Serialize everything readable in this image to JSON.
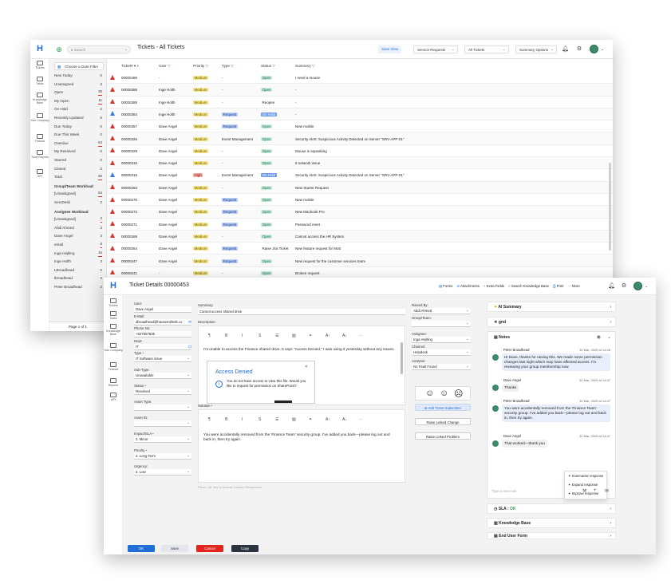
{
  "list_window": {
    "search_placeholder": "Search",
    "title": "Tickets - All Tickets",
    "save_view": "Save View",
    "dropdowns": [
      "Service Requests",
      "All Tickets",
      "Summary Options"
    ],
    "nav": [
      "Tickets",
      "Tasks",
      "Knowledge Base",
      "Your Company",
      "Finance",
      "Tools Reports",
      "API"
    ],
    "date_filter": "Choose a Date Filter",
    "filters": [
      {
        "label": "New Today",
        "count": "0"
      },
      {
        "label": "Unassigned",
        "count": "3"
      },
      {
        "label": "Open",
        "count": "35"
      },
      {
        "label": "My Open",
        "count": "11"
      },
      {
        "label": "On Hold",
        "count": "2"
      },
      {
        "label": "Recently Updated",
        "count": "6"
      },
      {
        "label": "Due Today",
        "count": "0"
      },
      {
        "label": "Due This Week",
        "count": "0"
      },
      {
        "label": "Overdue",
        "count": "54"
      },
      {
        "label": "My Resolved",
        "count": "0"
      },
      {
        "label": "Starred",
        "count": "0"
      },
      {
        "label": "Closed",
        "count": "0"
      },
      {
        "label": "Total",
        "count": "56"
      }
    ],
    "group_header": "Group/Team Workload",
    "groups": [
      {
        "label": "[Unassigned]",
        "count": "54"
      },
      {
        "label": "ServDesk",
        "count": "2"
      }
    ],
    "assignee_header": "Assignee Workload",
    "assignees": [
      {
        "label": "[Unassigned]",
        "count": "3"
      },
      {
        "label": "Abdi Ahmed",
        "count": "3"
      },
      {
        "label": "Dave Angel",
        "count": "3"
      },
      {
        "label": "email",
        "count": "8"
      },
      {
        "label": "Inga Hejlting",
        "count": "16"
      },
      {
        "label": "Inge Holth",
        "count": "3"
      },
      {
        "label": "LBroadhead",
        "count": "2"
      },
      {
        "label": "lbroadhead",
        "count": "2"
      },
      {
        "label": "Peter Broadhead",
        "count": "2"
      }
    ],
    "page_label": "Page 1 of 1",
    "columns": [
      "Ticket#",
      "User",
      "Priority",
      "Type",
      "Status",
      "Summary"
    ],
    "rows": [
      {
        "id": "00000486",
        "user": "-",
        "priority": "Medium",
        "type": "-",
        "status": "Open",
        "summary": "I need a mouse",
        "icon": "red"
      },
      {
        "id": "00000386",
        "user": "Inge Holth",
        "priority": "Medium",
        "type": "-",
        "status": "Open",
        "summary": "-",
        "icon": "red"
      },
      {
        "id": "00000385",
        "user": "Inge Holth",
        "priority": "Medium",
        "type": "-",
        "status": "Reopen",
        "summary": "-",
        "icon": "red"
      },
      {
        "id": "00000384",
        "user": "Inge Holth",
        "priority": "Medium",
        "type": "Request",
        "status": "On Hold",
        "summary": "-",
        "icon": "blue"
      },
      {
        "id": "00000357",
        "user": "Dave Angel",
        "priority": "Medium",
        "type": "Request",
        "status": "Open",
        "summary": "New mobile",
        "icon": "red"
      },
      {
        "id": "00000325",
        "user": "Dave Angel",
        "priority": "Medium",
        "type": "Event Management",
        "status": "Open",
        "summary": "Security Alert: Suspicious Activity Detected on Server \"SRV-APP-01\"",
        "icon": "red"
      },
      {
        "id": "00000329",
        "user": "Dave Angel",
        "priority": "Medium",
        "type": "-",
        "status": "Open",
        "summary": "Mouse is squeaking",
        "icon": "red"
      },
      {
        "id": "00000316",
        "user": "Dave Angel",
        "priority": "Medium",
        "type": "-",
        "status": "Open",
        "summary": "8 network issue",
        "icon": "red"
      },
      {
        "id": "00000315",
        "user": "Dave Angel",
        "priority": "High",
        "type": "Event Management",
        "status": "On Hold",
        "summary": "Security Alert: Suspicious Activity Detected on Server \"SRV-APP-01\"",
        "icon": "blue"
      },
      {
        "id": "00000283",
        "user": "Dave Angel",
        "priority": "Medium",
        "type": "-",
        "status": "Open",
        "summary": "New Starter Request",
        "icon": "red"
      },
      {
        "id": "00000276",
        "user": "Dave Angel",
        "priority": "Medium",
        "type": "Request",
        "status": "Open",
        "summary": "New mobile",
        "icon": "red"
      },
      {
        "id": "00000272",
        "user": "Dave Angel",
        "priority": "Medium",
        "type": "Request",
        "status": "Open",
        "summary": "New Macbook Pro",
        "icon": "red"
      },
      {
        "id": "00000271",
        "user": "Dave Angel",
        "priority": "Medium",
        "type": "Request",
        "status": "Open",
        "summary": "Password reset",
        "icon": "red"
      },
      {
        "id": "00000269",
        "user": "Dave Angel",
        "priority": "Medium",
        "type": "-",
        "status": "Open",
        "summary": "Cannot access the HR System",
        "icon": "red"
      },
      {
        "id": "00000264",
        "user": "Dave Angel",
        "priority": "Medium",
        "type": "Request",
        "status": "Raise Jira Ticket",
        "summary": "New feature request for Mott",
        "icon": "red"
      },
      {
        "id": "00000247",
        "user": "Dave Angel",
        "priority": "Medium",
        "type": "Request",
        "status": "Open",
        "summary": "New request for the customer services team",
        "icon": "red"
      },
      {
        "id": "00000241",
        "user": "-",
        "priority": "Medium",
        "type": "-",
        "status": "Open",
        "summary": "Broken request",
        "icon": "red"
      }
    ]
  },
  "detail_window": {
    "title": "Ticket Details 00000453",
    "toolbar": [
      "Forms",
      "Attachments",
      "Extra Fields",
      "Search Knowledge Base",
      "Print",
      "More"
    ],
    "nav": [
      "Tickets",
      "Tasks",
      "Knowledge Base",
      "Your Company",
      "Finance",
      "Reports",
      "API"
    ],
    "left_fields": [
      {
        "label": "User:",
        "value": "Dave Angel",
        "required": false,
        "dropdown": false
      },
      {
        "label": "E-Mail:",
        "value": "dbroadhead@hausemithelit.co",
        "required": false,
        "dropdown": false
      },
      {
        "label": "Phone No:",
        "value": "+527557835",
        "required": false,
        "dropdown": false
      },
      {
        "label": "Dept:",
        "value": "IT",
        "required": false,
        "dropdown": false
      },
      {
        "label": "Type",
        "value": "IT Software issue",
        "required": true,
        "dropdown": true
      },
      {
        "label": "Sub-Type:",
        "value": "Unavailable",
        "required": false,
        "dropdown": true
      },
      {
        "label": "Status",
        "value": "Resolved",
        "required": true,
        "dropdown": true
      },
      {
        "label": "Asset Type:",
        "value": "",
        "required": false,
        "dropdown": true
      },
      {
        "label": "Asset ID:",
        "value": "",
        "required": false,
        "dropdown": true
      },
      {
        "label": "Impact/SLA",
        "value": "2. Minor",
        "required": true,
        "dropdown": true
      },
      {
        "label": "Priority",
        "value": "4. Long Term",
        "required": true,
        "dropdown": true
      },
      {
        "label": "Urgency:",
        "value": "2. Low",
        "required": false,
        "dropdown": true
      }
    ],
    "summary_label": "Summary:",
    "summary_value": "Cannot access shared drive",
    "description_label": "Description:",
    "description_text": "I'm unable to access the Finance shared drive. It says \"Access Denied.\" I was using it yesterday without any issues.",
    "dialog_title": "Access Denied",
    "dialog_text": "You do not have access to view this file. Would you like to request for permission on SharePoint?",
    "solution_label": "Solution",
    "solution_text": "You were accidentally removed from the 'Finance Team' security group. I've added you back—please log out and back in, then try again.",
    "hint": "Press '/@' key to access Canned Responses",
    "mid_fields": [
      {
        "label": "Raised By:",
        "value": "Abdi Ahmed"
      },
      {
        "label": "Group/Team:",
        "value": ""
      },
      {
        "label": "Assignee:",
        "value": "Inga Hejlting"
      },
      {
        "label": "Channel:",
        "value": "Helpdesk"
      },
      {
        "label": "Analysis:",
        "value": "No Fault Found"
      }
    ],
    "add_subscriber": "Add Ticket Subscriber",
    "link_change": "Raise Linked Change",
    "link_problem": "Raise Linked Problem",
    "ai_summary": "AI Summary",
    "gnd": "gnd",
    "notes_label": "Notes",
    "notes": [
      {
        "author": "Peter Broadhead",
        "date": "31 Mar, 2025 at 14:46",
        "text": "Hi Dave, thanks for raising this. We made some permission changes last night which may have affected access. I'm reviewing your group membership now."
      },
      {
        "author": "Dave Angel",
        "date": "31 Mar, 2025 at 14:47",
        "text": "Thanks"
      },
      {
        "author": "Peter Broadhead",
        "date": "31 Mar, 2025 at 14:47",
        "text": "You were accidentally removed from the 'Finance Team' security group. I've added you back—please log out and back in, then try again."
      },
      {
        "author": "Dave Angel",
        "date": "31 Mar, 2025 at 14:47",
        "text": "That worked—thank you"
      }
    ],
    "ai_menu": [
      "Summarise response",
      "Expand response",
      "Improve response"
    ],
    "note_placeholder": "Type a new note",
    "sla_label": "SLA :",
    "sla_value": "OK",
    "kb_label": "Knowledge Base",
    "end_user_label": "End User Form",
    "buttons": {
      "ok": "OK",
      "save": "Save",
      "cancel": "Cancel",
      "copy": "Copy"
    }
  }
}
